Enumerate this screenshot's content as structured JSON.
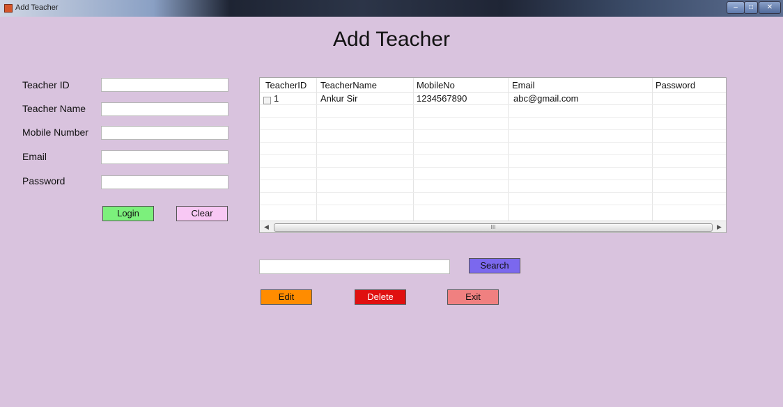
{
  "window": {
    "title": "Add Teacher"
  },
  "heading": "Add Teacher",
  "form": {
    "teacher_id_label": "Teacher ID",
    "teacher_name_label": "Teacher Name",
    "mobile_label": "Mobile Number",
    "email_label": "Email",
    "password_label": "Password",
    "teacher_id_value": "",
    "teacher_name_value": "",
    "mobile_value": "",
    "email_value": "",
    "password_value": "",
    "login_label": "Login",
    "clear_label": "Clear"
  },
  "grid": {
    "columns": [
      "TeacherID",
      "TeacherName",
      "MobileNo",
      "Email",
      "Password"
    ],
    "rows": [
      {
        "TeacherID": "1",
        "TeacherName": "Ankur Sir",
        "MobileNo": "1234567890",
        "Email": "abc@gmail.com",
        "Password": ""
      }
    ],
    "scroll_thumb_glyph": "III"
  },
  "search": {
    "value": "",
    "button_label": "Search"
  },
  "actions": {
    "edit_label": "Edit",
    "delete_label": "Delete",
    "exit_label": "Exit"
  },
  "colors": {
    "background": "#d9c3de",
    "login": "#7cf07c",
    "clear": "#f8c8f4",
    "search": "#7b68ee",
    "edit": "#ff8c00",
    "delete": "#e01010",
    "exit": "#f08080"
  }
}
